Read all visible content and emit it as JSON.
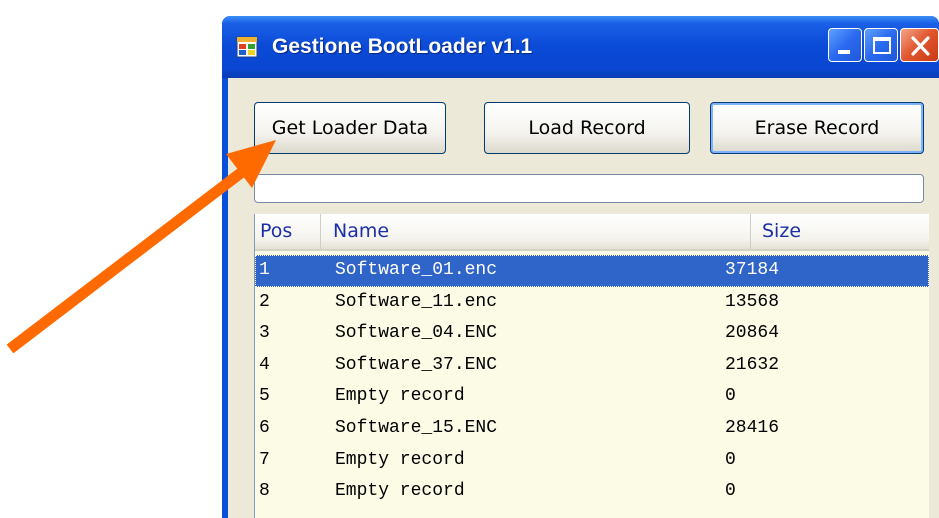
{
  "window": {
    "title": "Gestione BootLoader v1.1"
  },
  "toolbar": {
    "get_label": "Get Loader Data",
    "load_label": "Load Record",
    "erase_label": "Erase Record"
  },
  "list": {
    "columns": {
      "pos": "Pos",
      "name": "Name",
      "size": "Size"
    },
    "rows": [
      {
        "pos": "1",
        "name": "Software_01.enc",
        "size": "37184"
      },
      {
        "pos": "2",
        "name": "Software_11.enc",
        "size": "13568"
      },
      {
        "pos": "3",
        "name": "Software_04.ENC",
        "size": "20864"
      },
      {
        "pos": "4",
        "name": "Software_37.ENC",
        "size": "21632"
      },
      {
        "pos": "5",
        "name": "Empty record",
        "size": "0"
      },
      {
        "pos": "6",
        "name": "Software_15.ENC",
        "size": "28416"
      },
      {
        "pos": "7",
        "name": "Empty record",
        "size": "0"
      },
      {
        "pos": "8",
        "name": "Empty record",
        "size": "0"
      }
    ],
    "selected_row": "1"
  },
  "colors": {
    "titlebar": "#0a4ad6",
    "selection": "#2f64c8",
    "list_background": "#fcfbe6",
    "header_text": "#1b2fa8",
    "annotation_arrow": "#ff6a00"
  },
  "icons": {
    "app": "app-window-icon",
    "minimize": "minimize-icon",
    "maximize": "maximize-icon",
    "close": "close-icon",
    "annotation": "arrow-icon"
  }
}
